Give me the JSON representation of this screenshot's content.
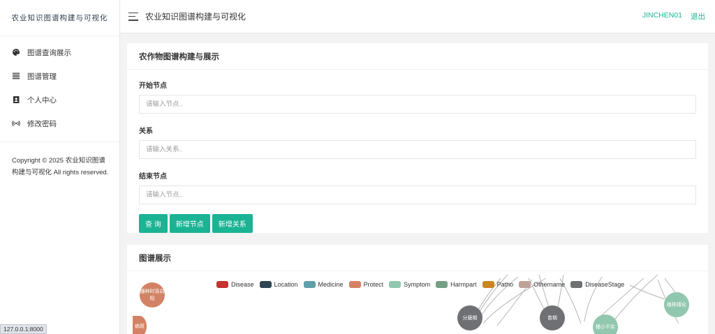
{
  "sidebar": {
    "brand": "农业知识图谱构建与可视化",
    "items": [
      {
        "label": "图谱查询展示"
      },
      {
        "label": "图谱管理"
      },
      {
        "label": "个人中心"
      },
      {
        "label": "修改密码"
      }
    ],
    "copyright": "Copyright © 2025 农业知识图谱构建与可视化 All rights reserved."
  },
  "topbar": {
    "title": "农业知识图谱构建与可视化",
    "user": "JINCHEN01",
    "logout": "退出"
  },
  "query_panel": {
    "title": "农作物图谱构建与展示",
    "start_label": "开始节点",
    "start_placeholder": "请输入节点..",
    "relation_label": "关系",
    "relation_placeholder": "请输入关系..",
    "end_label": "结束节点",
    "end_placeholder": "请输入节点..",
    "buttons": {
      "query": "查 询",
      "add_node": "新增节点",
      "add_relation": "新增关系"
    }
  },
  "graph_panel": {
    "title": "图谱展示",
    "legend": [
      {
        "name": "Disease",
        "color": "#c23531"
      },
      {
        "name": "Location",
        "color": "#2f4554"
      },
      {
        "name": "Medicine",
        "color": "#61a0a8"
      },
      {
        "name": "Protect",
        "color": "#d48265"
      },
      {
        "name": "Symptom",
        "color": "#91c7ae"
      },
      {
        "name": "Harmpart",
        "color": "#749f83"
      },
      {
        "name": "Patho",
        "color": "#ca8622"
      },
      {
        "name": "Othername",
        "color": "#bda29a"
      },
      {
        "name": "DiseaseStage",
        "color": "#6e7074"
      }
    ],
    "nodes": {
      "n1": "播种时背向阳",
      "n2": "分蘖期",
      "n3": "苗期",
      "n4": "穗小不实",
      "n5": "植株矮化",
      "n6": "病斑"
    }
  },
  "statusbar": {
    "url": "127.0.0.1:8000"
  }
}
